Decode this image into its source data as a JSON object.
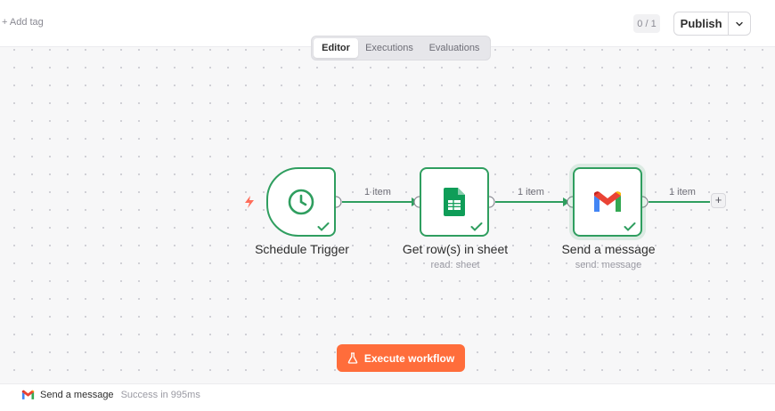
{
  "header": {
    "add_tag": "+ Add tag",
    "counter": "0 / 1",
    "publish_label": "Publish"
  },
  "tabs": [
    {
      "label": "Editor",
      "active": true
    },
    {
      "label": "Executions",
      "active": false
    },
    {
      "label": "Evaluations",
      "active": false
    }
  ],
  "nodes": [
    {
      "title": "Schedule Trigger",
      "subtitle": "",
      "icon": "clock-icon",
      "status": "success"
    },
    {
      "title": "Get row(s) in sheet",
      "subtitle": "read: sheet",
      "icon": "google-sheets-icon",
      "status": "success"
    },
    {
      "title": "Send a message",
      "subtitle": "send: message",
      "icon": "gmail-icon",
      "status": "success",
      "selected": true
    }
  ],
  "edges": [
    {
      "label": "1 item"
    },
    {
      "label": "1 item"
    },
    {
      "label": "1 item"
    }
  ],
  "execute_button": {
    "label": "Execute workflow",
    "icon": "flask-icon"
  },
  "log": {
    "node_name": "Send a message",
    "status": "Success in 995ms",
    "icon": "gmail-icon"
  },
  "colors": {
    "success": "#2f9e5f",
    "accent": "#ff6d3b",
    "trigger_bolt": "#ff6d5a"
  }
}
